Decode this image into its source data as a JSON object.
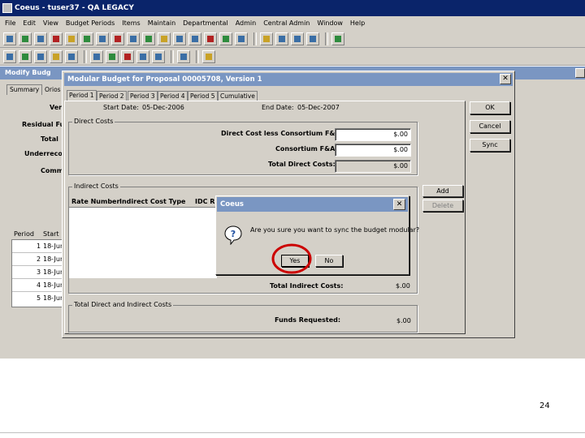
{
  "app": {
    "title": "Coeus - tuser37 - QA LEGACY"
  },
  "menu": [
    "File",
    "Edit",
    "View",
    "Budget Periods",
    "Items",
    "Maintain",
    "Departmental",
    "Admin",
    "Central Admin",
    "Window",
    "Help"
  ],
  "background_window": {
    "title": "Modify Budg",
    "tab_summary": "Summary",
    "tab_other": "Orios",
    "labels": [
      "Ver",
      "Residual Fu",
      "Total",
      "Underreco",
      "Comm"
    ],
    "period_table": {
      "headers": [
        "Period",
        "Start"
      ],
      "rows": [
        {
          "period": "1",
          "start": "18-Jun"
        },
        {
          "period": "2",
          "start": "18-Jun"
        },
        {
          "period": "3",
          "start": "18-Jun"
        },
        {
          "period": "4",
          "start": "18-Jun"
        },
        {
          "period": "5",
          "start": "18-Jun"
        }
      ]
    }
  },
  "dialog": {
    "title": "Modular Budget for Proposal 00005708, Version 1",
    "tabs": [
      "Period 1",
      "Period 2",
      "Period 3",
      "Period 4",
      "Period 5",
      "Cumulative"
    ],
    "start_date_label": "Start Date:",
    "start_date": "05-Dec-2006",
    "end_date_label": "End Date:",
    "end_date": "05-Dec-2007",
    "direct_costs": {
      "title": "Direct Costs",
      "less_consortium_label": "Direct Cost less Consortium F&A:",
      "less_consortium_value": "$.00",
      "consortium_label": "Consortium F&A:",
      "consortium_value": "$.00",
      "total_label": "Total Direct Costs:",
      "total_value": "$.00"
    },
    "indirect_costs": {
      "title": "Indirect Costs",
      "columns": [
        "Rate Number",
        "Indirect Cost Type",
        "IDC R"
      ],
      "total_label": "Total Indirect Costs:",
      "total_value": "$.00"
    },
    "total_section": {
      "title": "Total Direct and Indirect Costs",
      "funds_label": "Funds Requested:",
      "funds_value": "$.00"
    },
    "buttons": {
      "ok": "OK",
      "cancel": "Cancel",
      "sync": "Sync",
      "add": "Add",
      "delete": "Delete"
    }
  },
  "confirm": {
    "title": "Coeus",
    "message": "Are you sure you want to sync the budget modular?",
    "yes": "Yes",
    "no": "No"
  },
  "slide_number": "24",
  "colors": {
    "titlebar": "#0a246a",
    "face": "#d4d0c8",
    "highlight": "#cc0000"
  }
}
